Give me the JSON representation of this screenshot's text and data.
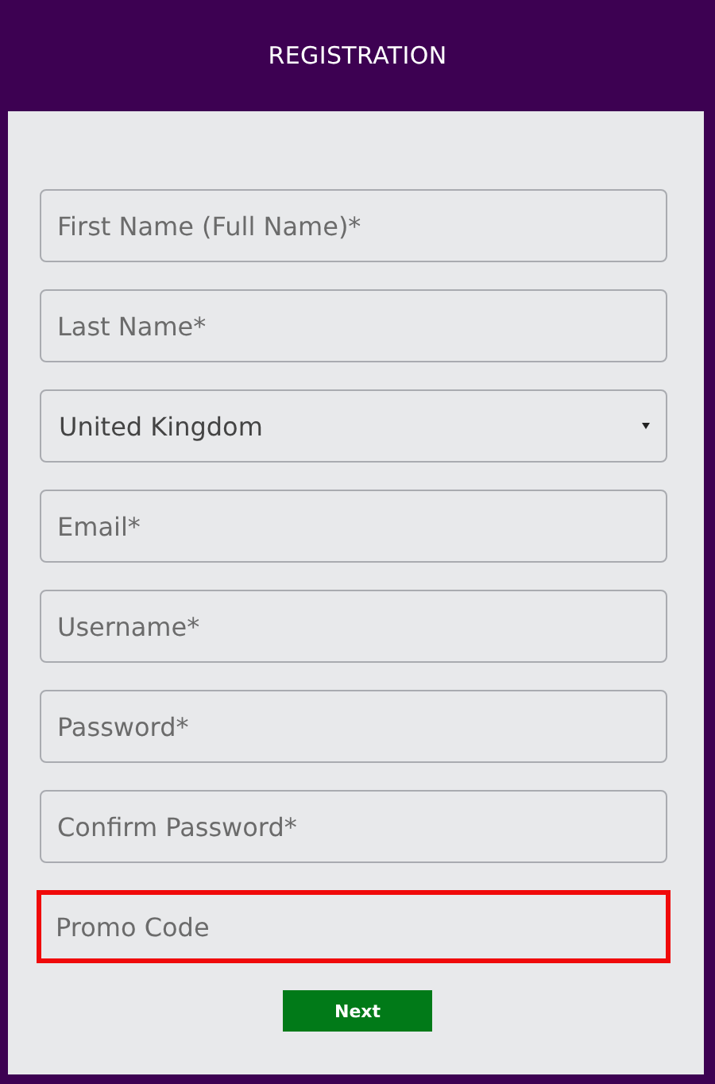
{
  "header": {
    "title": "REGISTRATION"
  },
  "fields": [
    {
      "kind": "input",
      "placeholder": "First Name (Full Name)*",
      "highlighted": false
    },
    {
      "kind": "input",
      "placeholder": "Last Name*",
      "highlighted": false
    },
    {
      "kind": "select",
      "value": "United Kingdom",
      "highlighted": false
    },
    {
      "kind": "input",
      "placeholder": "Email*",
      "highlighted": false
    },
    {
      "kind": "input",
      "placeholder": "Username*",
      "highlighted": false
    },
    {
      "kind": "input",
      "placeholder": "Password*",
      "highlighted": false
    },
    {
      "kind": "input",
      "placeholder": "Confirm Password*",
      "highlighted": false
    },
    {
      "kind": "input",
      "placeholder": "Promo Code",
      "highlighted": true
    }
  ],
  "buttons": [
    "Next"
  ]
}
